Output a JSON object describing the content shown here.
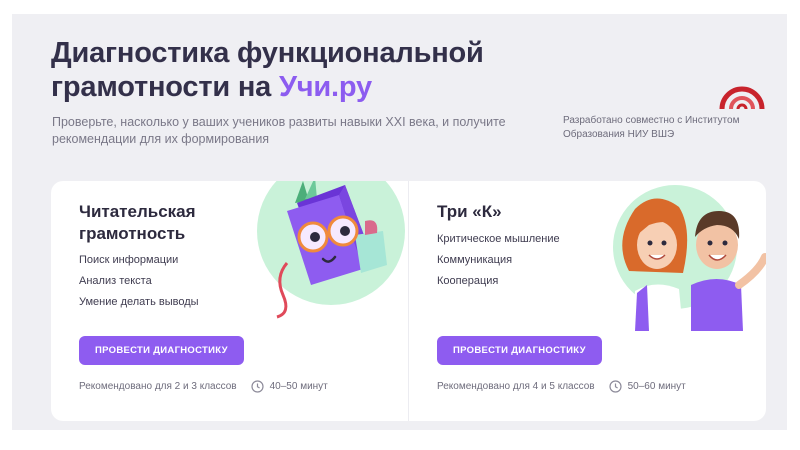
{
  "header": {
    "title_line1": "Диагностика функциональной",
    "title_line2_prefix": "грамотности на ",
    "title_brand": "Учи.ру",
    "subtitle": "Проверьте, насколько у ваших учеников развиты навыки XXI века, и получите рекомендации для их формирования",
    "partner_text": "Разработано совместно с Институтом Образования НИУ ВШЭ",
    "partner_logo_icon": "hse-arc-logo"
  },
  "cards": [
    {
      "title": "Читательская грамотность",
      "skills": [
        "Поиск информации",
        "Анализ текста",
        "Умение делать выводы"
      ],
      "button_label": "ПРОВЕСТИ ДИАГНОСТИКУ",
      "recommended": "Рекомендовано для 2 и 3 классов",
      "duration": "40–50 минут",
      "illustration": "book-character-illustration"
    },
    {
      "title": "Три «К»",
      "skills": [
        "Критическое мышление",
        "Коммуникация",
        "Кооперация"
      ],
      "button_label": "ПРОВЕСТИ ДИАГНОСТИКУ",
      "recommended": "Рекомендовано для 4 и 5 классов",
      "duration": "50–60 минут",
      "illustration": "children-illustration"
    }
  ],
  "colors": {
    "accent": "#8e5cf0",
    "brand_text": "#8c5cf0",
    "background_panel": "#efeff3",
    "illustration_bg": "#c9f2d9",
    "logo_red": "#c8232c"
  }
}
